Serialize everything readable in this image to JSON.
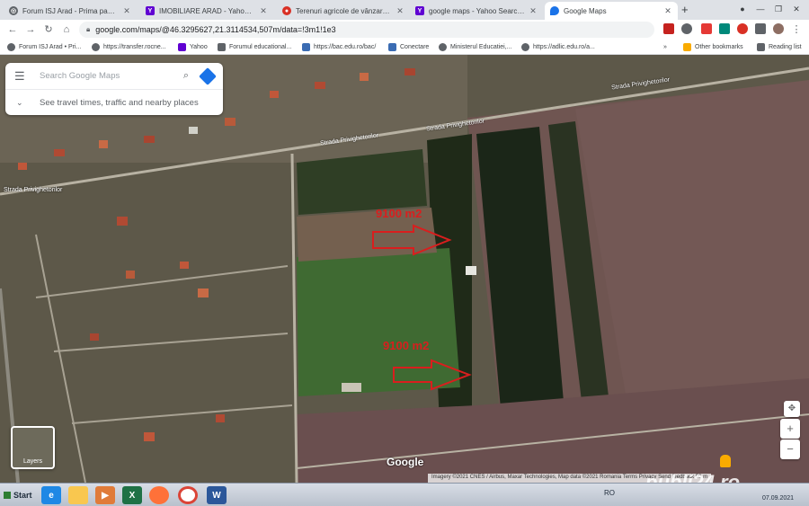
{
  "browser": {
    "tabs": [
      {
        "label": "Forum ISJ Arad - Prima pagină",
        "favicon": "globe-icon",
        "color": "#5f6368"
      },
      {
        "label": "IMOBILIARE ARAD - Yahoo Search Resu...",
        "favicon": "yahoo-icon",
        "color": "#6001d2"
      },
      {
        "label": "Terenuri agricole de vânzare în județ...",
        "favicon": "site-icon",
        "color": "#d93025"
      },
      {
        "label": "google maps - Yahoo Search Results",
        "favicon": "yahoo-icon",
        "color": "#6001d2"
      },
      {
        "label": "Google Maps",
        "favicon": "maps-pin-icon",
        "color": "#1a73e8"
      }
    ],
    "new_tab": "+",
    "url": "google.com/maps/@46.3295627,21.3114534,507m/data=!3m1!1e3",
    "bookmarks": [
      {
        "label": "Forum ISJ Arad • Pri...",
        "color": "#5f6368"
      },
      {
        "label": "https://transfer.rocne...",
        "color": "#5f6368"
      },
      {
        "label": "Yahoo",
        "color": "#6001d2"
      },
      {
        "label": "Forumul educational...",
        "color": "#5f6368"
      },
      {
        "label": "https://bac.edu.ro/bac/",
        "color": "#3b6cb3"
      },
      {
        "label": "Conectare",
        "color": "#3b6cb3"
      },
      {
        "label": "Ministerul Educatiei,...",
        "color": "#5f6368"
      },
      {
        "label": "https://adlic.edu.ro/a...",
        "color": "#5f6368"
      }
    ],
    "other_bookmarks": "Other bookmarks",
    "reading_list": "Reading list"
  },
  "maps": {
    "search_placeholder": "Search Google Maps",
    "travel_hint": "See travel times, traffic and nearby places",
    "layers_label": "Layers",
    "logo": "Google",
    "attribution": "Imagery ©2021 CNES / Airbus, Maxar Technologies, Map data ©2021   Romania   Terms   Privacy   Send feedback   50 m",
    "street_labels": [
      "Strada Privighetorilor",
      "Strada Privighetorilor",
      "Strada Privighetorilor",
      "Strada Privighetorilor"
    ],
    "annotations": [
      "9100 m2",
      "9100 m2"
    ],
    "watermark": "publi24.ro"
  },
  "taskbar": {
    "start": "Start",
    "apps": [
      "ie-icon",
      "explorer-icon",
      "media-icon",
      "excel-icon",
      "firefox-icon",
      "chrome-icon",
      "word-icon"
    ],
    "language": "RO",
    "date": "07.09.2021"
  }
}
